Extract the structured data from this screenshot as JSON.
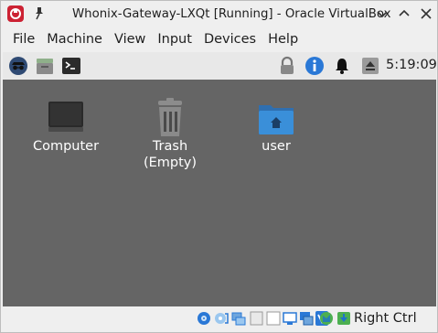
{
  "window": {
    "title": "Whonix-Gateway-LXQt [Running] - Oracle VirtualBox"
  },
  "menubar": {
    "items": [
      {
        "label": "File"
      },
      {
        "label": "Machine"
      },
      {
        "label": "View"
      },
      {
        "label": "Input"
      },
      {
        "label": "Devices"
      },
      {
        "label": "Help"
      }
    ]
  },
  "panel": {
    "launchers": [
      "start-menu-icon",
      "file-manager-icon",
      "terminal-icon"
    ],
    "tray": [
      "lock-icon",
      "info-icon",
      "notification-bell-icon",
      "eject-icon"
    ],
    "clock": "5:19:09"
  },
  "desktop": {
    "background": "#656565",
    "icons": [
      {
        "label": "Computer",
        "icon": "computer-icon"
      },
      {
        "label": "Trash",
        "sublabel": "(Empty)",
        "icon": "trash-icon"
      },
      {
        "label": "user",
        "icon": "home-folder-icon"
      }
    ]
  },
  "statusbar": {
    "host_key": "Right Ctrl",
    "indicators": [
      "hard-disk-icon",
      "optical-drive-icon",
      "audio-icon",
      "network-icon",
      "usb-icon",
      "shared-folders-icon",
      "display-icon",
      "video-capture-icon",
      "cpu-icon",
      "mouse-integration-icon",
      "keyboard-icon"
    ]
  },
  "colors": {
    "chrome": "#efefef",
    "desktop": "#656565",
    "folder_blue": "#3a8fd9",
    "info_blue": "#2a78d6",
    "app_red": "#cc2233"
  }
}
